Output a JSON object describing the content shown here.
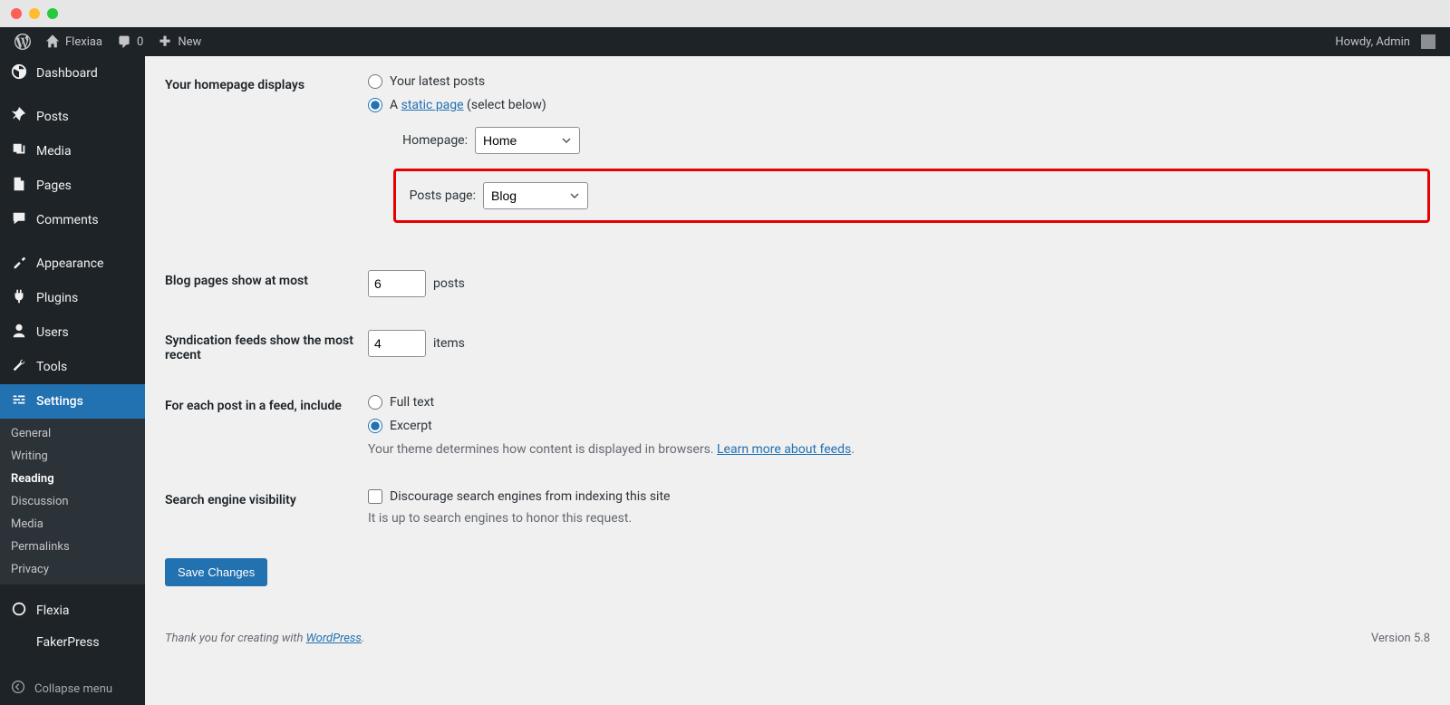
{
  "adminbar": {
    "site_name": "Flexiaa",
    "comments_count": "0",
    "new_label": "New",
    "howdy": "Howdy, Admin"
  },
  "sidebar": {
    "items": [
      {
        "label": "Dashboard"
      },
      {
        "label": "Posts"
      },
      {
        "label": "Media"
      },
      {
        "label": "Pages"
      },
      {
        "label": "Comments"
      },
      {
        "label": "Appearance"
      },
      {
        "label": "Plugins"
      },
      {
        "label": "Users"
      },
      {
        "label": "Tools"
      },
      {
        "label": "Settings"
      },
      {
        "label": "Flexia"
      },
      {
        "label": "FakerPress"
      }
    ],
    "settings_sub": [
      {
        "label": "General"
      },
      {
        "label": "Writing"
      },
      {
        "label": "Reading"
      },
      {
        "label": "Discussion"
      },
      {
        "label": "Media"
      },
      {
        "label": "Permalinks"
      },
      {
        "label": "Privacy"
      }
    ],
    "collapse": "Collapse menu"
  },
  "form": {
    "homepage_displays_label": "Your homepage displays",
    "radio_latest": "Your latest posts",
    "radio_static_prefix": "A ",
    "radio_static_link": "static page",
    "radio_static_suffix": " (select below)",
    "homepage_label": "Homepage:",
    "homepage_value": "Home",
    "postspage_label": "Posts page:",
    "postspage_value": "Blog",
    "blog_pages_label": "Blog pages show at most",
    "posts_per_page": "6",
    "posts_unit": "posts",
    "syndication_label": "Syndication feeds show the most recent",
    "syndication_count": "4",
    "syndication_unit": "items",
    "feed_include_label": "For each post in a feed, include",
    "radio_fulltext": "Full text",
    "radio_excerpt": "Excerpt",
    "feed_hint_prefix": "Your theme determines how content is displayed in browsers. ",
    "feed_hint_link": "Learn more about feeds",
    "feed_hint_suffix": ".",
    "sev_label": "Search engine visibility",
    "sev_checkbox": "Discourage search engines from indexing this site",
    "sev_hint": "It is up to search engines to honor this request.",
    "submit": "Save Changes"
  },
  "footer": {
    "thanks_prefix": "Thank you for creating with ",
    "thanks_link": "WordPress",
    "thanks_suffix": ".",
    "version": "Version 5.8"
  }
}
